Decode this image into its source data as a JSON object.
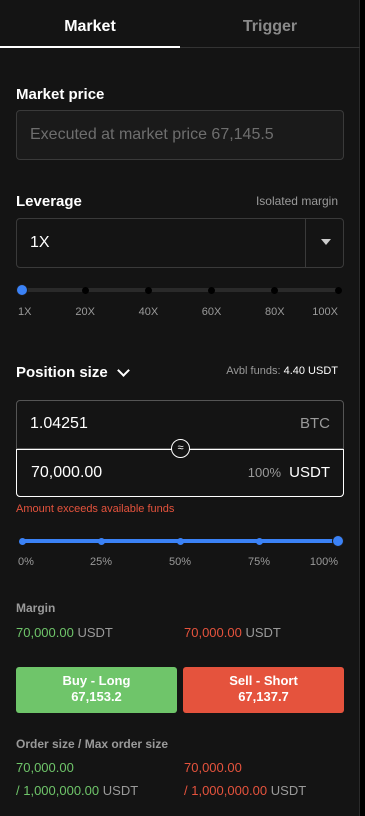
{
  "tabs": {
    "market": "Market",
    "trigger": "Trigger"
  },
  "market_price": {
    "label": "Market price",
    "placeholder": "Executed at market price 67,145.5"
  },
  "leverage": {
    "label": "Leverage",
    "mode": "Isolated margin",
    "selected": "1X",
    "ticks": [
      "1X",
      "20X",
      "40X",
      "60X",
      "80X",
      "100X"
    ],
    "level_fraction": 0
  },
  "position_size": {
    "label": "Position size",
    "avbl_label": "Avbl funds:",
    "avbl_value": "4.40 USDT",
    "base_value": "1.04251",
    "base_unit": "BTC",
    "swap_icon": "≈",
    "quote_value": "70,000.00",
    "quote_pct": "100%",
    "quote_unit": "USDT",
    "error": "Amount exceeds available funds",
    "ticks": [
      "0%",
      "25%",
      "50%",
      "75%",
      "100%"
    ],
    "level_fraction": 1
  },
  "margin": {
    "label": "Margin",
    "long_value": "70,000.00",
    "long_unit": "USDT",
    "short_value": "70,000.00",
    "short_unit": "USDT"
  },
  "buttons": {
    "buy_label": "Buy - Long",
    "buy_price": "67,153.2",
    "sell_label": "Sell - Short",
    "sell_price": "67,137.7"
  },
  "order_size": {
    "label": "Order size / Max order size",
    "long_value": "70,000.00",
    "long_max": "/ 1,000,000.00",
    "long_unit": "USDT",
    "short_value": "70,000.00",
    "short_max": "/ 1,000,000.00",
    "short_unit": "USDT"
  },
  "colors": {
    "accent": "#3b82f6",
    "long": "#6fc56a",
    "short": "#e5533d",
    "background": "#141414"
  }
}
